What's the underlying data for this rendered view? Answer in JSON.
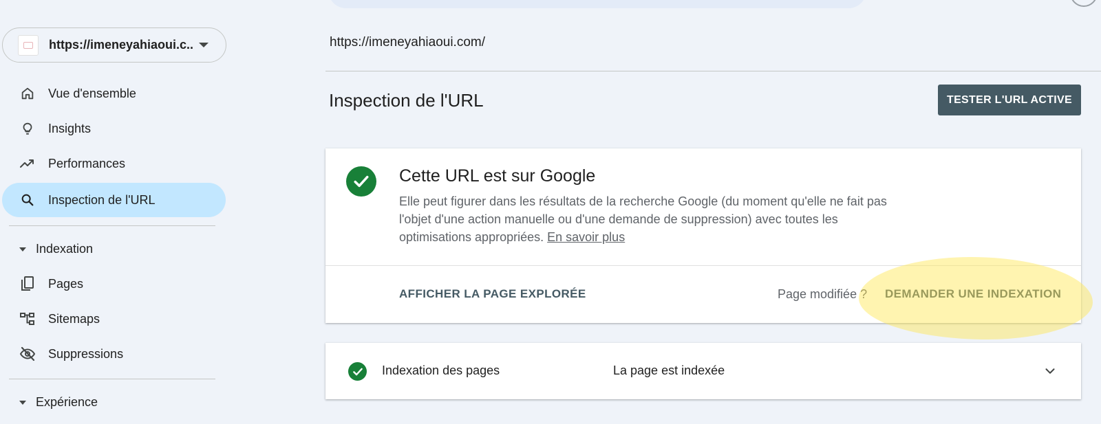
{
  "property": {
    "label": "https://imeneyahiaoui.c..."
  },
  "sidebar": {
    "items": [
      {
        "label": "Vue d'ensemble",
        "icon": "home-icon"
      },
      {
        "label": "Insights",
        "icon": "lightbulb-icon"
      },
      {
        "label": "Performances",
        "icon": "trending-up-icon"
      },
      {
        "label": "Inspection de l'URL",
        "icon": "search-icon",
        "active": true
      }
    ],
    "sections": [
      {
        "label": "Indexation",
        "items": [
          {
            "label": "Pages",
            "icon": "pages-icon"
          },
          {
            "label": "Sitemaps",
            "icon": "sitemap-icon"
          },
          {
            "label": "Suppressions",
            "icon": "visibility-off-icon"
          }
        ]
      },
      {
        "label": "Expérience",
        "items": []
      }
    ]
  },
  "main": {
    "url": "https://imeneyahiaoui.com/",
    "title": "Inspection de l'URL",
    "test_live_button": "TESTER L'URL ACTIVE",
    "status_card": {
      "title": "Cette URL est sur Google",
      "description": "Elle peut figurer dans les résultats de la recherche Google (du moment qu'elle ne fait pas l'objet d'une action manuelle ou d'une demande de suppression) avec toutes les optimisations appropriées.",
      "learn_more": "En savoir plus",
      "view_crawled": "AFFICHER LA PAGE EXPLORÉE",
      "page_modified": "Page modifiée ?",
      "request_indexing": "DEMANDER UNE INDEXATION"
    },
    "indexation_card": {
      "label": "Indexation des pages",
      "value": "La page est indexée"
    }
  },
  "colors": {
    "background": "#eff3f9",
    "active_nav": "#c2e7ff",
    "success_green": "#188038",
    "button_dark": "#455a64",
    "highlight": "#ffe650"
  }
}
